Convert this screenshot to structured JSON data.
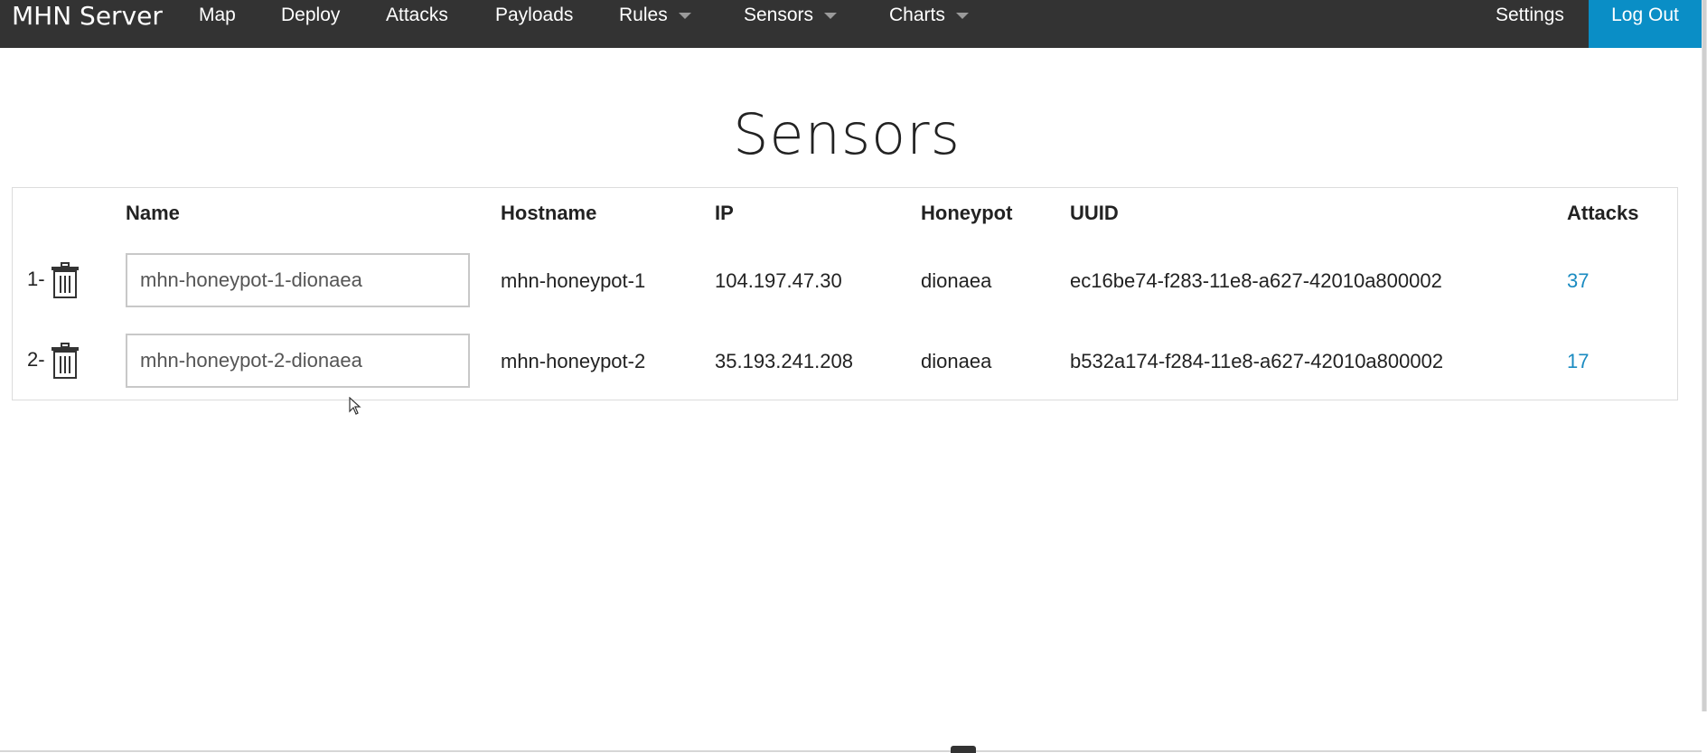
{
  "nav": {
    "brand": "MHN Server",
    "items": [
      {
        "label": "Map"
      },
      {
        "label": "Deploy"
      },
      {
        "label": "Attacks"
      },
      {
        "label": "Payloads"
      },
      {
        "label": "Rules",
        "dropdown": true
      },
      {
        "label": "Sensors",
        "dropdown": true
      },
      {
        "label": "Charts",
        "dropdown": true
      }
    ],
    "settings": "Settings",
    "logout": "Log Out",
    "accent_color": "#0a8ec6",
    "bar_color": "#333333"
  },
  "page": {
    "title": "Sensors"
  },
  "table": {
    "headers": [
      "Name",
      "Hostname",
      "IP",
      "Honeypot",
      "UUID",
      "Attacks"
    ],
    "rows": [
      {
        "index": "1-",
        "name": "mhn-honeypot-1-dionaea",
        "hostname": "mhn-honeypot-1",
        "ip": "104.197.47.30",
        "honeypot": "dionaea",
        "uuid": "ec16be74-f283-11e8-a627-42010a800002",
        "attacks": "37",
        "delete_icon": "trash-icon"
      },
      {
        "index": "2-",
        "name": "mhn-honeypot-2-dionaea",
        "hostname": "mhn-honeypot-2",
        "ip": "35.193.241.208",
        "honeypot": "dionaea",
        "uuid": "b532a174-f284-11e8-a627-42010a800002",
        "attacks": "17",
        "delete_icon": "trash-icon"
      }
    ],
    "link_color": "#1a8bc1"
  }
}
